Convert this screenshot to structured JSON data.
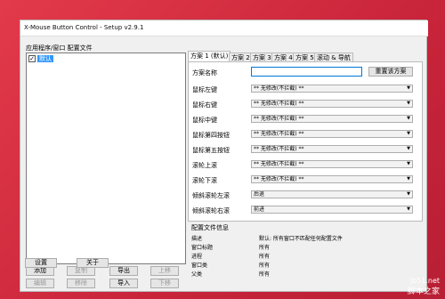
{
  "window": {
    "title": "X-Mouse Button Control - Setup v2.9.1"
  },
  "left": {
    "label": "应用程序/窗口 配置文件",
    "list_items": [
      {
        "checked": true,
        "label": "默认"
      }
    ],
    "buttons": [
      {
        "label": "添加",
        "enabled": true
      },
      {
        "label": "复制",
        "enabled": false
      },
      {
        "label": "导出",
        "enabled": true
      },
      {
        "label": "上移",
        "enabled": false
      },
      {
        "label": "编辑",
        "enabled": false
      },
      {
        "label": "移除",
        "enabled": false
      },
      {
        "label": "导入",
        "enabled": true
      },
      {
        "label": "下移",
        "enabled": false
      }
    ]
  },
  "tabs": [
    {
      "label": "方案 1 (默认)",
      "active": true
    },
    {
      "label": "方案 2",
      "active": false
    },
    {
      "label": "方案 3",
      "active": false
    },
    {
      "label": "方案 4",
      "active": false
    },
    {
      "label": "方案 5",
      "active": false
    },
    {
      "label": "滚动 & 导航",
      "active": false
    }
  ],
  "panel": {
    "scheme_name_label": "方案名称",
    "scheme_name_value": "",
    "reset_label": "重置该方案",
    "rows": [
      {
        "label": "鼠标左键",
        "value": "** 无修改(不拦截) **"
      },
      {
        "label": "鼠标右键",
        "value": "** 无修改(不拦截) **"
      },
      {
        "label": "鼠标中键",
        "value": "** 无修改(不拦截) **"
      },
      {
        "label": "鼠标第四按钮",
        "value": "** 无修改(不拦截) **"
      },
      {
        "label": "鼠标第五按钮",
        "value": "** 无修改(不拦截) **"
      },
      {
        "label": "滚轮上滚",
        "value": "** 无修改(不拦截) **"
      },
      {
        "label": "滚轮下滚",
        "value": "** 无修改(不拦截) **"
      },
      {
        "label": "倾斜滚轮左滚",
        "value": "后退"
      },
      {
        "label": "倾斜滚轮右滚",
        "value": "前进"
      }
    ]
  },
  "info": {
    "title": "配置文件信息",
    "rows": [
      {
        "label": "描述",
        "value": "默认: 所有窗口不匹配任何配置文件"
      },
      {
        "label": "窗口标题",
        "value": "所有"
      },
      {
        "label": "进程",
        "value": "所有"
      },
      {
        "label": "窗口类",
        "value": "所有"
      },
      {
        "label": "父类",
        "value": "所有"
      }
    ]
  },
  "bottom": {
    "settings_label": "设置",
    "about_label": "关于"
  },
  "watermark": {
    "site": "jb51.net",
    "brand": "脚本之家"
  }
}
